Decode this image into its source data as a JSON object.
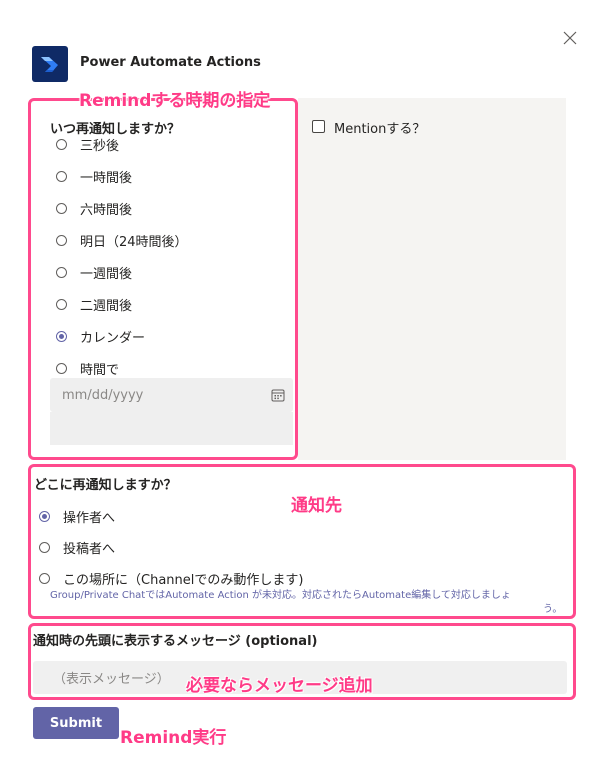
{
  "header": {
    "title": "Power Automate Actions"
  },
  "annotations": {
    "when": "Remindする時期の指定",
    "where": "通知先",
    "message": "必要ならメッセージ追加",
    "submit": "Remind実行"
  },
  "when": {
    "question": "いつ再通知しますか？",
    "options": [
      "三秒後",
      "一時間後",
      "六時間後",
      "明日（24時間後）",
      "一週間後",
      "二週間後",
      "カレンダー",
      "時間で"
    ],
    "selected": "カレンダー",
    "date_placeholder": "mm/dd/yyyy"
  },
  "mention": {
    "label": "Mentionする？",
    "checked": false
  },
  "where": {
    "question": "どこに再通知しますか？",
    "options": [
      "操作者へ",
      "投稿者へ",
      "この場所に（Channelでのみ動作します)"
    ],
    "selected": "操作者へ",
    "note_line1": "Group/Private ChatではAutomate Action が未対応。対応されたらAutomate編集して対応しましょ",
    "note_line2": "う。"
  },
  "message": {
    "label": "通知時の先頭に表示するメッセージ (optional)",
    "placeholder": "（表示メッセージ）"
  },
  "submit": {
    "label": "Submit"
  },
  "colors": {
    "accent": "#6264a7",
    "annotation": "#ff4a8d",
    "app_icon": "#0f2a66"
  }
}
